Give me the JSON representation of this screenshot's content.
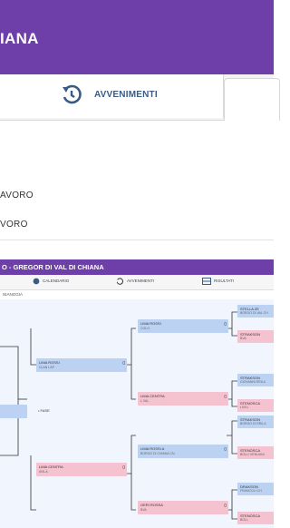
{
  "header": {
    "title": "IANA"
  },
  "tabs": {
    "events_label": "AVVENIMENTI"
  },
  "rows": [
    {
      "label": "AVORO"
    },
    {
      "label": "VORO"
    }
  ],
  "colors": {
    "brand": "#6e3fa8",
    "tab_text": "#3a5b86",
    "team_a": "#bcd2f3",
    "team_b": "#f5c2cf"
  },
  "mini": {
    "title": "O - GREGOR DI VAL DI CHIANA",
    "tabs": [
      "CALENDARIO",
      "AVVENIMENTI",
      "RISULTATI"
    ],
    "subtitle": "NIANGGIA",
    "bye_label": "• FASE",
    "boxes": [
      {
        "t1": "LIMA ROSSI",
        "t2": "COLO",
        "sc": "0"
      },
      {
        "t1": "LIMA ROSSI",
        "t2": "CLAN LAP",
        "sc": "0"
      },
      {
        "t1": "LIMA CENTRA",
        "t2": "L VAL",
        "sc": "0"
      },
      {
        "t1": "LIMA ROSSI A",
        "t2": "BORGO DI CHIANA CN",
        "sc": "0"
      },
      {
        "t1": "LIMA CENTRA",
        "t2": "AVILA",
        "sc": "0"
      },
      {
        "t1": "GERI ROSSA",
        "t2": "BVA",
        "sc": "0"
      }
    ],
    "right": [
      {
        "t1": "STELLA ZE",
        "t2": "BORGO DI VAL CH"
      },
      {
        "t1": "STRAKSON",
        "t2": "BVA"
      },
      {
        "t1": "STRAKSON",
        "t2": "GIOVANNI ERILA"
      },
      {
        "t1": "STENOSCA",
        "t2": "LIVILI"
      },
      {
        "t1": "STRAKSON",
        "t2": "BORGO DI ERILA"
      },
      {
        "t1": "STENOSCA",
        "t2": "BOLLI VENLIANI"
      },
      {
        "t1": "DRAKSON",
        "t2": "FRANCOLI CH"
      },
      {
        "t1": "STENOSCA",
        "t2": "BOLL"
      }
    ]
  }
}
